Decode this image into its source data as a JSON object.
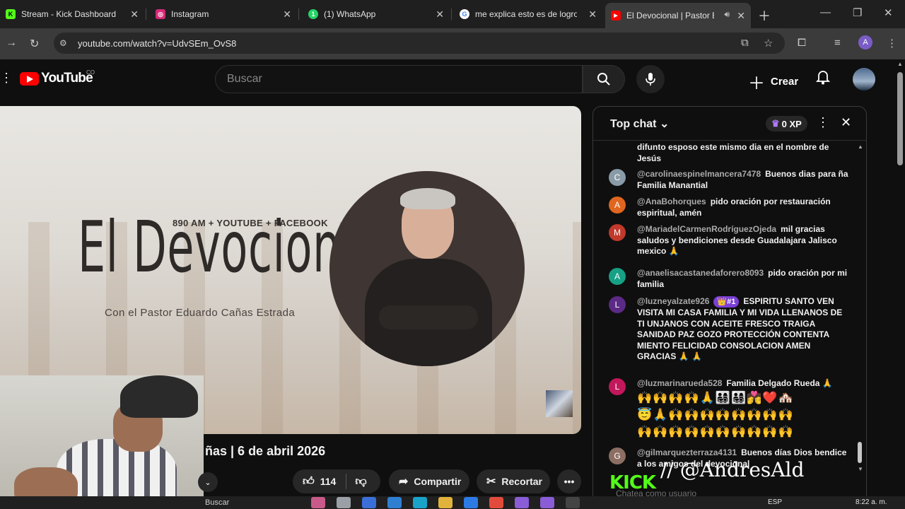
{
  "browser": {
    "tabs": [
      {
        "label": "Stream - Kick Dashboard",
        "icon": "kick-icon",
        "color": "#53fc18",
        "glyph": "K"
      },
      {
        "label": "Instagram",
        "icon": "instagram-icon",
        "color": "#d62976",
        "glyph": "◎"
      },
      {
        "label": "(1) WhatsApp",
        "icon": "whatsapp-icon",
        "color": "#25d366",
        "glyph": "1"
      },
      {
        "label": "me explica esto es de logro",
        "icon": "google-icon",
        "color": "#4285f4",
        "glyph": "G"
      },
      {
        "label": "El Devocional | Pastor Ed",
        "icon": "youtube-icon",
        "color": "#ff0000",
        "glyph": "▶"
      }
    ],
    "url": "youtube.com/watch?v=UdvSEm_OvS8",
    "profile_initial": "A"
  },
  "youtube": {
    "logo_text": "YouTube",
    "country_code": "CO",
    "search_placeholder": "Buscar",
    "create_label": "Crear"
  },
  "video": {
    "overlay_subtitle": "890 AM + YOUTUBE + FACEBOOK",
    "overlay_brand": "El Devocional",
    "overlay_host": "Con el Pastor Eduardo Cañas Estrada",
    "title_visible": "ñas | 6 de abril 2026",
    "likes": "114",
    "share_label": "Compartir",
    "clip_label": "Recortar"
  },
  "chat": {
    "title": "Top chat",
    "xp": "0 XP",
    "messages": [
      {
        "author": "",
        "text": "difunto esposo este mismo dia en el nombre de Jesús",
        "initial": "",
        "color": "#0f0f0f"
      },
      {
        "author": "@carolinaespinelmancera7478",
        "text": "Buenos dias para ña Familia Manantial",
        "initial": "C",
        "color": "#8a9ba8"
      },
      {
        "author": "@AnaBohorques",
        "text": "pido oración por restauración espiritual, amén",
        "initial": "A",
        "color": "#e0661f"
      },
      {
        "author": "@MariadelCarmenRodríguezOjeda",
        "text": "mil gracias saludos y bendiciones desde Guadalajara Jalisco mexico 🙏",
        "initial": "M",
        "color": "#c0392b"
      },
      {
        "author": "@anaelisacastanedaforero8093",
        "text": "pido oración por mi familia",
        "initial": "A",
        "color": "#16a085"
      },
      {
        "author": "@luzneyalzate926",
        "badge": "👑#1",
        "text": "ESPIRITU SANTO VEN VISITA MI CASA FAMILIA Y MI VIDA LLENANOS DE TI UNJANOS CON ACEITE FRESCO TRAIGA SANIDAD PAZ GOZO PROTECCIÓN CONTENTA MIENTO FELICIDAD CONSOLACION AMEN GRACIAS 🙏 🙏",
        "initial": "L",
        "color": "#5b2a86"
      },
      {
        "author": "@luzmarinarueda528",
        "text": "Familia Delgado Rueda 🙏",
        "initial": "L",
        "color": "#c2185b",
        "emoji_lines": [
          "🙌🙌🙌🙌🙏👨‍👩‍👧‍👦👨‍👩‍👧‍👦💏❤️🏘️",
          "😇🙏🙌🙌🙌🙌🙌🙌🙌🙌",
          "🙌🙌🙌🙌🙌🙌🙌🙌🙌🙌"
        ]
      },
      {
        "author": "@gilmarquezterraza4131",
        "text": "Buenos días Dios bendice a los amigos del devocional",
        "initial": "G",
        "color": "#8d6e63"
      }
    ],
    "input_placeholder": "Chatea como usuario"
  },
  "overlay": {
    "kick_logo": "KICK",
    "handle": "// @AndresAld"
  },
  "taskbar": {
    "search": "Buscar",
    "lang": "ESP",
    "time": "8:22 a. m."
  }
}
